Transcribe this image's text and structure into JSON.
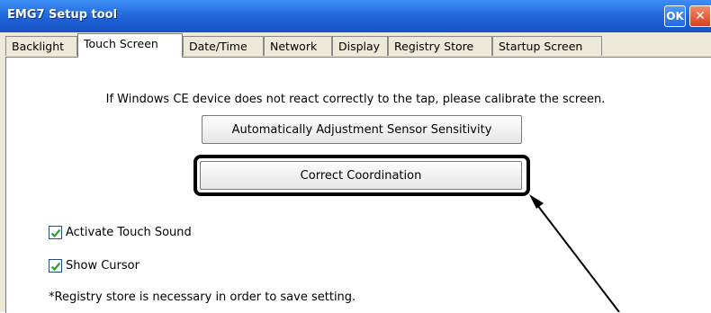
{
  "window": {
    "title": "EMG7 Setup tool",
    "ok_label": "OK",
    "close_label": "✕"
  },
  "tabs": [
    {
      "label": "Backlight",
      "active": false
    },
    {
      "label": "Touch Screen",
      "active": true
    },
    {
      "label": "Date/Time",
      "active": false
    },
    {
      "label": "Network",
      "active": false
    },
    {
      "label": "Display",
      "active": false
    },
    {
      "label": "Registry Store",
      "active": false
    },
    {
      "label": "Startup Screen",
      "active": false
    }
  ],
  "panel": {
    "instruction": "If Windows CE device does not react correctly to the tap, please calibrate the screen.",
    "auto_button": "Automatically Adjustment Sensor Sensitivity",
    "correct_button": "Correct Coordination",
    "checkboxes": [
      {
        "label": "Activate Touch Sound",
        "checked": true
      },
      {
        "label": "Show Cursor",
        "checked": true
      }
    ],
    "note": "*Registry store is necessary in order to save setting."
  },
  "colors": {
    "titlebar": "#1f63d8",
    "check": "#2e9e2e",
    "annotation": "#000000"
  }
}
